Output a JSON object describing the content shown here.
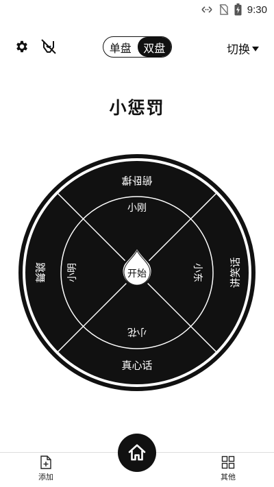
{
  "status_bar": {
    "time": "9:30",
    "icons": [
      "data-transfer-icon",
      "no-sim-icon",
      "battery-charging-icon"
    ]
  },
  "toolbar": {
    "settings_icon": "gear-icon",
    "sound_icon": "sound-off-icon",
    "mode_single": "单盘",
    "mode_double": "双盘",
    "mode_selected": "双盘",
    "switch_label": "切换"
  },
  "title": "小惩罚",
  "wheel": {
    "outer_items": [
      "俯卧撑",
      "讲笑话",
      "真心话",
      "跳舞"
    ],
    "inner_items": [
      "小刚",
      "小东",
      "小花",
      "小明"
    ],
    "start_label": "开始"
  },
  "bottom_nav": {
    "add_label": "添加",
    "other_label": "其他",
    "home_icon": "home-icon"
  },
  "colors": {
    "primary": "#111111",
    "background": "#ffffff"
  }
}
